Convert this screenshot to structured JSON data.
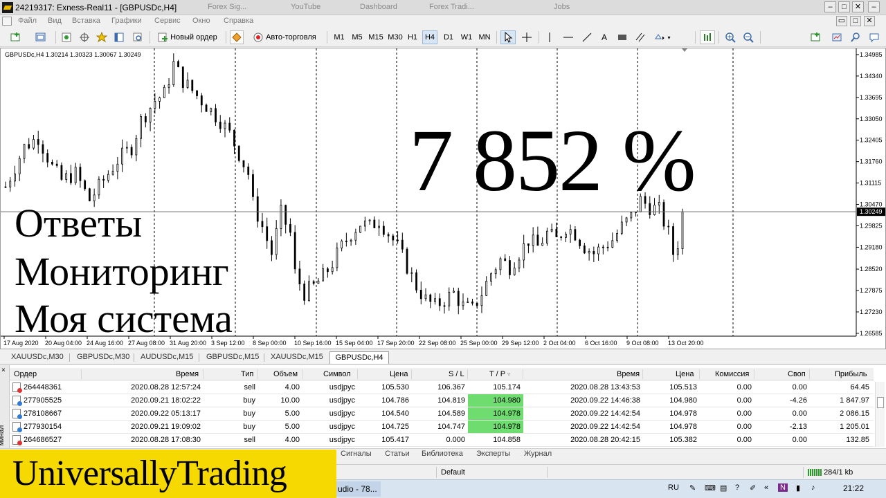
{
  "window": {
    "title": "24219317: Exness-Real11 - [GBPUSDc,H4]",
    "background_tabs": [
      "Forex Sig...",
      "YouTube",
      "Dashboard",
      "Forex Tradi...",
      "Jobs"
    ]
  },
  "menu": {
    "items": [
      "Файл",
      "Вид",
      "Вставка",
      "Графики",
      "Сервис",
      "Окно",
      "Справка"
    ]
  },
  "toolbar": {
    "new_order_label": "Новый ордер",
    "autotrading_label": "Авто-торговля",
    "timeframes": [
      "M1",
      "M5",
      "M15",
      "M30",
      "H1",
      "H4",
      "D1",
      "W1",
      "MN"
    ],
    "active_timeframe": "H4",
    "text_tool_label": "A"
  },
  "chart": {
    "info_line": "GBPUSDc,H4  1.30214 1.30323 1.30067 1.30249",
    "current_price_label": "1.30249",
    "overlay": {
      "big_percent": "7 852 %",
      "lines": [
        "Ответы",
        "Мониторинг",
        "Моя система"
      ]
    }
  },
  "chart_data": {
    "type": "candlestick",
    "symbol": "GBPUSDc",
    "timeframe": "H4",
    "y_ticks": [
      "1.34985",
      "1.34340",
      "1.33695",
      "1.33050",
      "1.32405",
      "1.31760",
      "1.31115",
      "1.30470",
      "1.29825",
      "1.29180",
      "1.28520",
      "1.27875",
      "1.27230",
      "1.26585"
    ],
    "x_ticks": [
      "17 Aug 2020",
      "20 Aug 04:00",
      "24 Aug 16:00",
      "27 Aug 08:00",
      "31 Aug 20:00",
      "3 Sep 12:00",
      "8 Sep 00:00",
      "10 Sep 16:00",
      "15 Sep 04:00",
      "17 Sep 20:00",
      "22 Sep 08:00",
      "25 Sep 00:00",
      "29 Sep 12:00",
      "2 Oct 04:00",
      "6 Oct 16:00",
      "9 Oct 08:00",
      "13 Oct 20:00"
    ],
    "ylim": [
      1.265,
      1.3513
    ],
    "current_price": 1.30249,
    "grid": "vertical-dashed",
    "close_path": [
      [
        0,
        1.31
      ],
      [
        4,
        1.322
      ],
      [
        7,
        1.325
      ],
      [
        10,
        1.316
      ],
      [
        12,
        1.312
      ],
      [
        15,
        1.314
      ],
      [
        18,
        1.306
      ],
      [
        21,
        1.312
      ],
      [
        24,
        1.318
      ],
      [
        27,
        1.322
      ],
      [
        29,
        1.33
      ],
      [
        32,
        1.336
      ],
      [
        34,
        1.338
      ],
      [
        36,
        1.347
      ],
      [
        38,
        1.342
      ],
      [
        40,
        1.339
      ],
      [
        42,
        1.336
      ],
      [
        44,
        1.333
      ],
      [
        46,
        1.33
      ],
      [
        48,
        1.326
      ],
      [
        50,
        1.32
      ],
      [
        52,
        1.314
      ],
      [
        53,
        1.305
      ],
      [
        55,
        1.298
      ],
      [
        57,
        1.29
      ],
      [
        59,
        1.302
      ],
      [
        61,
        1.296
      ],
      [
        62,
        1.284
      ],
      [
        64,
        1.278
      ],
      [
        66,
        1.28
      ],
      [
        68,
        1.283
      ],
      [
        70,
        1.287
      ],
      [
        72,
        1.292
      ],
      [
        74,
        1.296
      ],
      [
        76,
        1.299
      ],
      [
        78,
        1.298
      ],
      [
        80,
        1.3
      ],
      [
        82,
        1.296
      ],
      [
        84,
        1.292
      ],
      [
        86,
        1.286
      ],
      [
        88,
        1.28
      ],
      [
        90,
        1.276
      ],
      [
        92,
        1.274
      ],
      [
        94,
        1.276
      ],
      [
        96,
        1.278
      ],
      [
        98,
        1.274
      ],
      [
        100,
        1.273
      ],
      [
        102,
        1.278
      ],
      [
        104,
        1.284
      ],
      [
        106,
        1.288
      ],
      [
        108,
        1.286
      ],
      [
        110,
        1.29
      ],
      [
        112,
        1.294
      ],
      [
        114,
        1.292
      ],
      [
        116,
        1.296
      ],
      [
        118,
        1.294
      ],
      [
        120,
        1.298
      ],
      [
        122,
        1.296
      ],
      [
        124,
        1.292
      ],
      [
        126,
        1.29
      ],
      [
        128,
        1.292
      ],
      [
        130,
        1.294
      ],
      [
        132,
        1.298
      ],
      [
        134,
        1.301
      ],
      [
        136,
        1.306
      ],
      [
        138,
        1.304
      ],
      [
        140,
        1.303
      ],
      [
        142,
        1.296
      ],
      [
        143,
        1.29
      ],
      [
        144,
        1.293
      ],
      [
        145,
        1.302
      ]
    ]
  },
  "chart_tabs": [
    "XAUUSDc,M30",
    "GBPUSDc,M30",
    "AUDUSDc,M15",
    "GBPUSDc,M15",
    "XAUUSDc,M15",
    "GBPUSDc,H4"
  ],
  "active_chart_tab": "GBPUSDc,H4",
  "orders": {
    "columns": [
      "Ордер",
      "Время",
      "Тип",
      "Объем",
      "Символ",
      "Цена",
      "S / L",
      "T / P",
      "Время",
      "Цена",
      "Комиссия",
      "Своп",
      "Прибыль"
    ],
    "rows": [
      {
        "order": "264448361",
        "time_open": "2020.08.28 12:57:24",
        "type": "sell",
        "volume": "4.00",
        "symbol": "usdjpyc",
        "price_open": "105.530",
        "sl": "106.367",
        "tp": "105.174",
        "tp_hit": false,
        "time_close": "2020.08.28 13:43:53",
        "price_close": "105.513",
        "commission": "0.00",
        "swap": "0.00",
        "profit": "64.45"
      },
      {
        "order": "277905525",
        "time_open": "2020.09.21 18:02:22",
        "type": "buy",
        "volume": "10.00",
        "symbol": "usdjpyc",
        "price_open": "104.786",
        "sl": "104.819",
        "tp": "104.980",
        "tp_hit": true,
        "time_close": "2020.09.22 14:46:38",
        "price_close": "104.980",
        "commission": "0.00",
        "swap": "-4.26",
        "profit": "1 847.97"
      },
      {
        "order": "278108667",
        "time_open": "2020.09.22 05:13:17",
        "type": "buy",
        "volume": "5.00",
        "symbol": "usdjpyc",
        "price_open": "104.540",
        "sl": "104.589",
        "tp": "104.978",
        "tp_hit": true,
        "time_close": "2020.09.22 14:42:54",
        "price_close": "104.978",
        "commission": "0.00",
        "swap": "0.00",
        "profit": "2 086.15"
      },
      {
        "order": "277930154",
        "time_open": "2020.09.21 19:09:02",
        "type": "buy",
        "volume": "5.00",
        "symbol": "usdjpyc",
        "price_open": "104.725",
        "sl": "104.747",
        "tp": "104.978",
        "tp_hit": true,
        "time_close": "2020.09.22 14:42:54",
        "price_close": "104.978",
        "commission": "0.00",
        "swap": "-2.13",
        "profit": "1 205.01"
      },
      {
        "order": "264686527",
        "time_open": "2020.08.28 17:08:30",
        "type": "sell",
        "volume": "4.00",
        "symbol": "usdjpyc",
        "price_open": "105.417",
        "sl": "0.000",
        "tp": "104.858",
        "tp_hit": false,
        "time_close": "2020.08.28 20:42:15",
        "price_close": "105.382",
        "commission": "0.00",
        "swap": "0.00",
        "profit": "132.85"
      }
    ]
  },
  "terminal": {
    "side_label": "минал",
    "tabs": [
      "Сигналы",
      "Статьи",
      "Библиотека",
      "Эксперты",
      "Журнал"
    ]
  },
  "statusbar": {
    "profile": "Default",
    "traffic": "284/1 kb"
  },
  "taskbar": {
    "task_label": "udio - 78...",
    "lang": "RU",
    "clock": "21:22"
  },
  "brand": {
    "text": "UniversallyTrading",
    "color": "#f5d900"
  },
  "colors": {
    "tp_hit": "#6fdc6f",
    "candle": "#000000",
    "chart_bg": "#ffffff"
  }
}
